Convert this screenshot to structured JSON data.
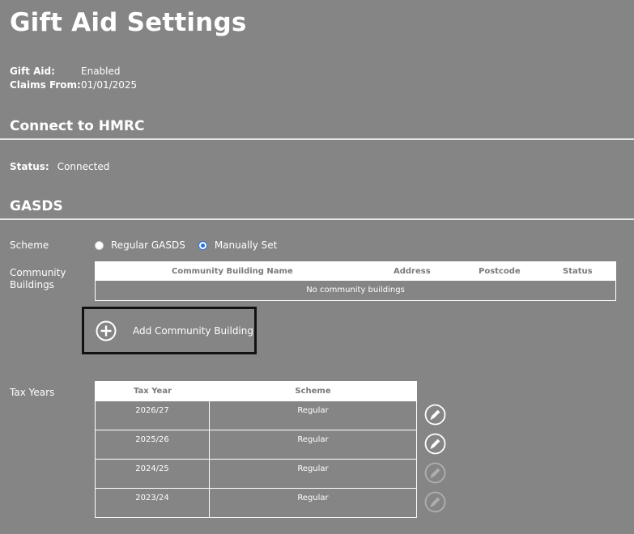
{
  "title": "Gift Aid Settings",
  "gift_aid": {
    "label": "Gift Aid:",
    "value": "Enabled",
    "claims_label": "Claims From:",
    "claims_value": "01/01/2025"
  },
  "hmrc": {
    "section_title": "Connect to HMRC",
    "status_label": "Status:",
    "status_value": "Connected"
  },
  "gasds": {
    "section_title": "GASDS",
    "scheme_label": "Scheme",
    "scheme_options": [
      {
        "label": "Regular GASDS",
        "selected": false
      },
      {
        "label": "Manually Set",
        "selected": true
      }
    ],
    "community_label_1": "Community",
    "community_label_2": "Buildings",
    "community_table": {
      "headers": [
        "Community Building Name",
        "Address",
        "Postcode",
        "Status"
      ],
      "empty_text": "No community buildings"
    },
    "add_button_label": "Add Community Building",
    "tax_years_label": "Tax Years",
    "tax_table": {
      "headers": [
        "Tax Year",
        "Scheme"
      ],
      "rows": [
        {
          "year": "2026/27",
          "scheme": "Regular",
          "editable": true
        },
        {
          "year": "2025/26",
          "scheme": "Regular",
          "editable": true
        },
        {
          "year": "2024/25",
          "scheme": "Regular",
          "editable": false
        },
        {
          "year": "2023/24",
          "scheme": "Regular",
          "editable": false
        }
      ]
    }
  },
  "colors": {
    "background": "#858585",
    "selected_radio": "#1d6fe0"
  },
  "icons": {
    "add": "plus-circle-icon",
    "edit": "pencil-circle-icon"
  }
}
